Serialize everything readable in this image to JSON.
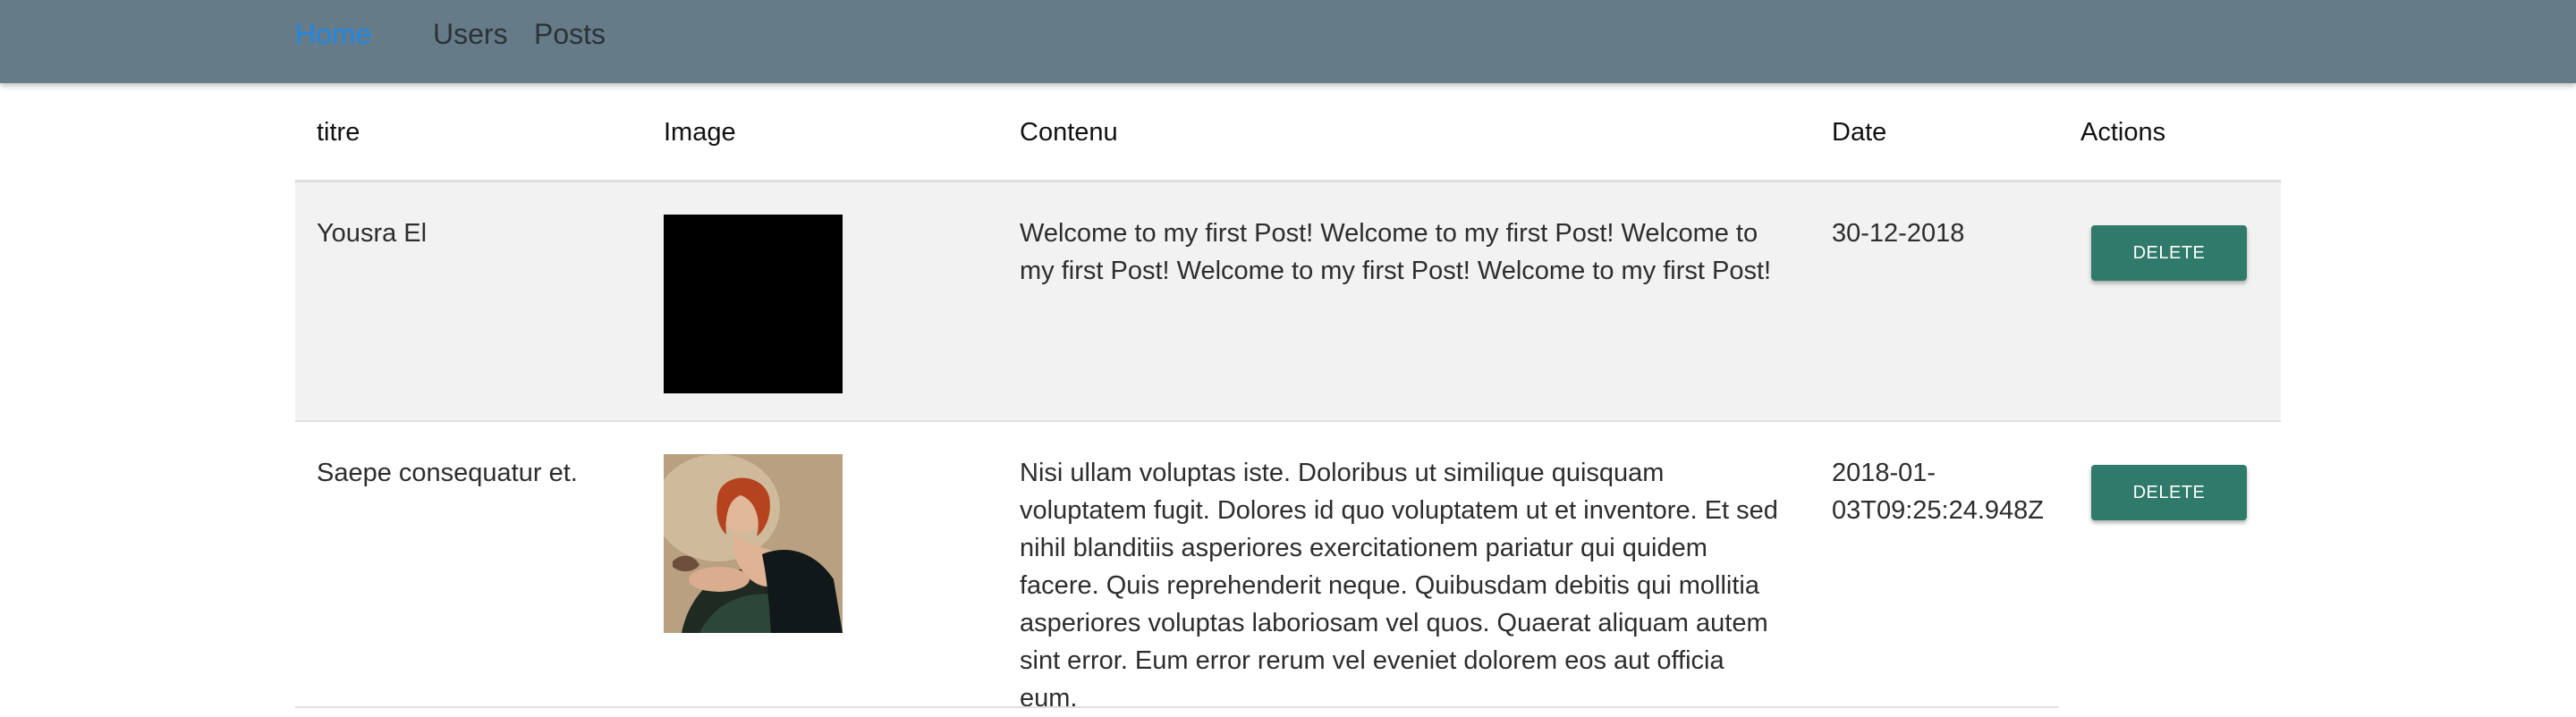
{
  "navbar": {
    "home_label": "Home",
    "users_label": "Users",
    "posts_label": "Posts",
    "active": "Home"
  },
  "table": {
    "headers": {
      "title": "titre",
      "image": "Image",
      "content": "Contenu",
      "date": "Date",
      "actions": "Actions"
    },
    "rows": [
      {
        "title": "Yousra El",
        "image": "black-thumbnail",
        "content": "Welcome to my first Post! Welcome to my first Post! Welcome to my first Post! Welcome to my first Post! Welcome to my first Post!",
        "date": "30-12-2018",
        "action_label": "DELETE"
      },
      {
        "title": "Saepe consequatur et.",
        "image": "portrait-photo-thumbnail",
        "content": "Nisi ullam voluptas iste. Doloribus ut similique quisquam voluptatem fugit. Dolores id quo voluptatem ut et inventore. Et sed nihil blanditiis asperiores exercitationem pariatur qui quidem facere. Quis reprehenderit neque. Quibusdam debitis qui mollitia asperiores voluptas laboriosam vel quos. Quaerat aliquam autem sint error. Eum error rerum vel eveniet dolorem eos aut officia eum.",
        "date": "2018-01-03T09:25:24.948Z",
        "action_label": "DELETE"
      }
    ]
  },
  "colors": {
    "navbar_bg": "#667b88",
    "active_link": "#1e88e5",
    "delete_button": "#2f7a6b",
    "shaded_row": "#f2f2f2"
  }
}
